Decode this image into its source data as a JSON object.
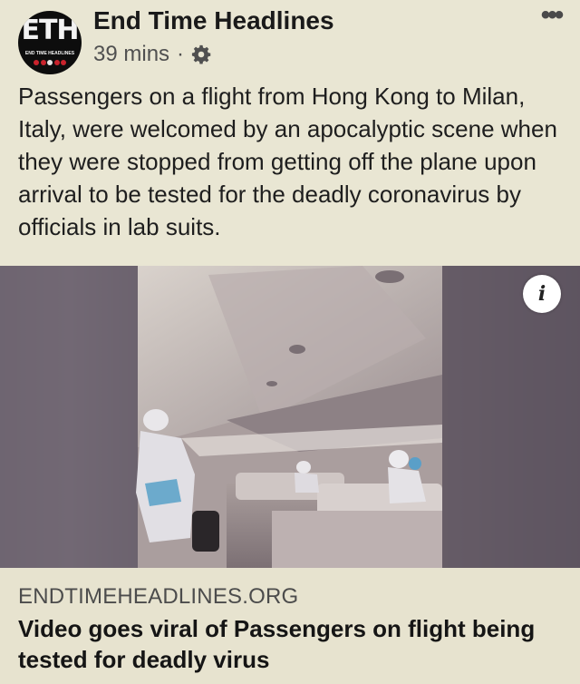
{
  "post": {
    "page_name": "End Time Headlines",
    "time": "39 mins",
    "separator": "·",
    "audience_icon": "gear-icon",
    "more_icon": "•••",
    "text": "Passengers on a flight from Hong Kong to Milan, Italy, were welcomed by an apocalyptic scene when they were stopped from getting off the plane upon arrival to be tested for the deadly coronavirus by officials in lab suits."
  },
  "avatar": {
    "letters": "ETH",
    "subtitle": "END TIME HEADLINES"
  },
  "link_card": {
    "info_icon": "i",
    "domain": "ENDTIMEHEADLINES.ORG",
    "headline": "Video goes viral of Passengers on flight being tested for deadly virus"
  },
  "colors": {
    "background": "#e9e6d3",
    "text": "#1c1c1c",
    "meta": "#505050"
  }
}
